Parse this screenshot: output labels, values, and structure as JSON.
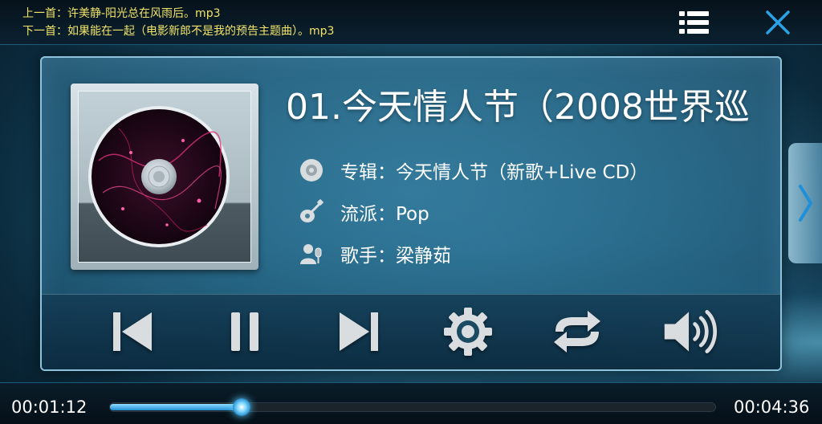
{
  "header": {
    "prev_track": "上一首：许美静-阳光总在风雨后。mp3",
    "next_track": "下一首：如果能在一起（电影新郎不是我的预告主题曲）。mp3"
  },
  "song": {
    "title": "01.今天情人节（2008世界巡",
    "album": "专辑：今天情人节（新歌+Live CD）",
    "genre": "流派：Pop",
    "artist": "歌手：梁静茹"
  },
  "controls": [
    "previous",
    "pause",
    "next",
    "settings",
    "repeat",
    "volume"
  ],
  "progress": {
    "elapsed": "00:01:12",
    "total": "00:04:36",
    "fraction": 0.217
  },
  "colors": {
    "track_text": "#f2e46a",
    "accent": "#2fa8e8",
    "icon": "#d9dde0"
  }
}
